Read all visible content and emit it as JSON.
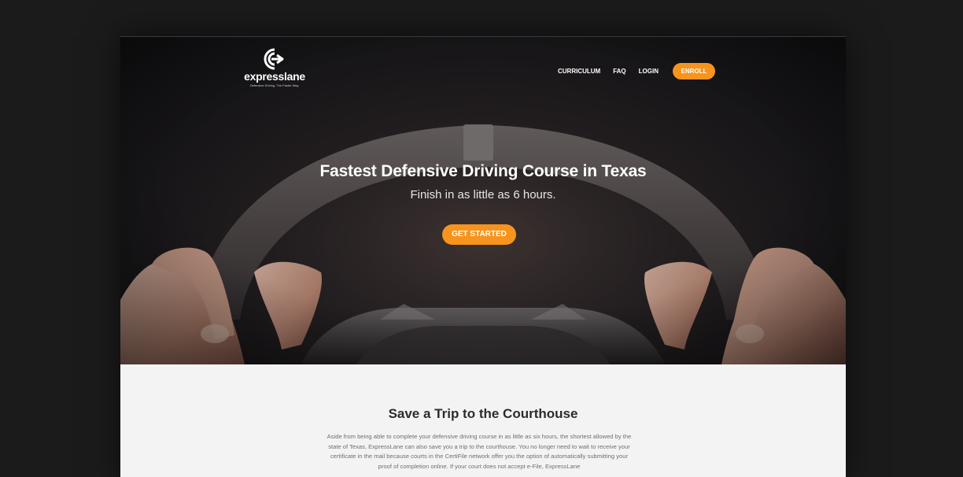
{
  "brand": {
    "name": "expresslane",
    "tagline": "Defensive Driving. The Faster Way.",
    "accent_color": "#f7941d"
  },
  "nav": {
    "links": [
      {
        "label": "CURRICULUM"
      },
      {
        "label": "FAQ"
      },
      {
        "label": "LOGIN"
      }
    ],
    "enroll_label": "ENROLL"
  },
  "hero": {
    "title": "Fastest Defensive Driving Course in Texas",
    "subtitle": "Finish in as little as 6 hours.",
    "cta_label": "GET STARTED",
    "image": "hands-on-steering-wheel"
  },
  "section": {
    "title": "Save a Trip to the Courthouse",
    "body": "Aside from being able to complete your defensive driving course in as little as six hours, the shortest allowed by the state of Texas, ExpressLane can also save you a trip to the courthouse. You no longer need to wait to receive your certificate in the mail because courts in the CertiFile network offer you the option of automatically submitting your proof of completion online. If your court does not accept e-File, ExpressLane"
  }
}
